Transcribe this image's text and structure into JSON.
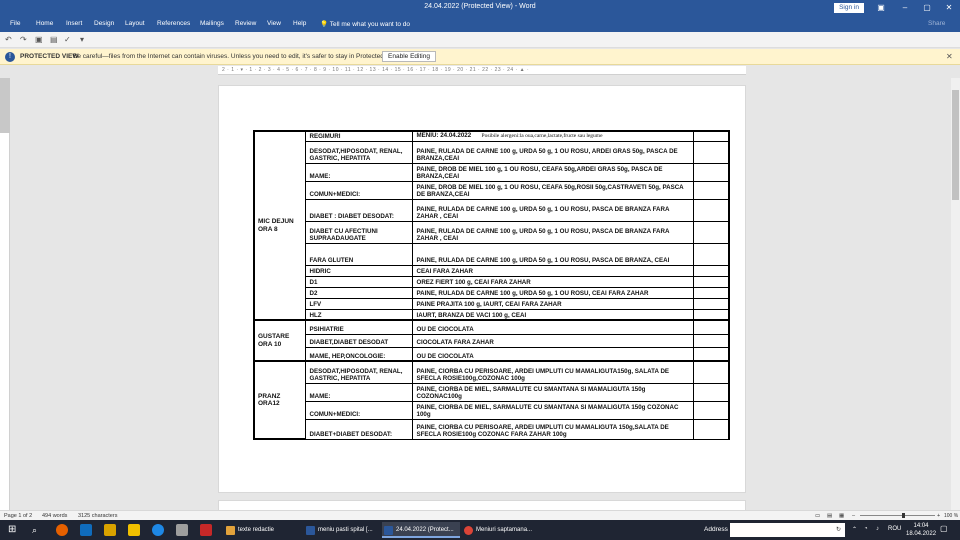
{
  "window": {
    "title": "24.04.2022 (Protected View) - Word",
    "sign_in": "Sign in"
  },
  "ribbon": {
    "tabs": [
      "File",
      "Home",
      "Insert",
      "Design",
      "Layout",
      "References",
      "Mailings",
      "Review",
      "View",
      "Help"
    ],
    "tell_me": "Tell me what you want to do",
    "share": "Share"
  },
  "protected_view": {
    "title": "PROTECTED VIEW",
    "message": "Be careful—files from the Internet can contain viruses. Unless you need to edit, it's safer to stay in Protected View.",
    "button": "Enable Editing"
  },
  "ruler": {
    "text": "2 · 1 · ▾ · 1 · 2 · 3 · 4 · 5 · 6 · 7 · 8 · 9 · 10 · 11 · 12 · 13 · 14 · 15 · 16 · 17 · 18 · 19 · 20 · 21 · 22 · 23 · 24 · ▲ ·"
  },
  "document": {
    "header_row": {
      "regimen": "REGIMURI",
      "menu": "MENIU: 24.04.2022",
      "note": "Posibile alergeni:la oua,carne,lactate,fructe sau legume"
    },
    "sections": [
      {
        "meal": "MIC DEJUN ORA 8",
        "rows": [
          {
            "regimen": "DESODAT,HIPOSODAT, RENAL, GASTRIC, HEPATITA",
            "menu": "PAINE, RULADA DE CARNE 100 g, URDA 50 g, 1 OU ROSU, ARDEI GRAS 50g, PASCA DE BRANZA,CEAI"
          },
          {
            "regimen": "MAME:",
            "menu": "PAINE, DROB DE MIEL 100 g, 1 OU ROSU, CEAFA 50g,ARDEI GRAS 50g, PASCA DE BRANZA,CEAI"
          },
          {
            "regimen": "COMUN+MEDICI:",
            "menu": "PAINE, DROB DE MIEL 100 g, 1 OU ROSU, CEAFA 50g,ROSII 50g,CASTRAVETI 50g, PASCA DE BRANZA,CEAI"
          },
          {
            "regimen": "DIABET : DIABET DESODAT:",
            "menu": "PAINE, RULADA DE CARNE 100 g, URDA 50 g, 1 OU ROSU, PASCA DE BRANZA FARA ZAHAR , CEAI"
          },
          {
            "regimen": "DIABET CU AFECTIUNI SUPRAADAUGATE",
            "menu": "PAINE, RULADA DE CARNE 100 g, URDA 50 g, 1 OU ROSU, PASCA DE BRANZA FARA ZAHAR , CEAI"
          },
          {
            "regimen": "FARA GLUTEN",
            "menu": "PAINE, RULADA DE CARNE 100 g, URDA 50 g, 1 OU ROSU, PASCA DE BRANZA, CEAI"
          },
          {
            "regimen": "HIDRIC",
            "menu": "CEAI FARA ZAHAR"
          },
          {
            "regimen": "D1",
            "menu": "OREZ FIERT 100 g, CEAI FARA ZAHAR"
          },
          {
            "regimen": "D2",
            "menu": "PAINE, RULADA DE CARNE 100 g, URDA 50 g, 1 OU ROSU, CEAI FARA ZAHAR"
          },
          {
            "regimen": "LFV",
            "menu": "PAINE PRAJITA 100 g, IAURT, CEAI FARA ZAHAR"
          },
          {
            "regimen": "HLZ",
            "menu": "IAURT, BRANZA DE VACI 100 g, CEAI"
          }
        ]
      },
      {
        "meal": "GUSTARE ORA 10",
        "rows": [
          {
            "regimen": "PSIHIATRIE",
            "menu": "OU DE CIOCOLATA"
          },
          {
            "regimen": "DIABET,DIABET DESODAT",
            "menu": "CIOCOLATA FARA ZAHAR"
          },
          {
            "regimen": "MAME, HEP,ONCOLOGIE:",
            "menu": "OU DE CIOCOLATA"
          }
        ]
      },
      {
        "meal": "PRANZ ORA12",
        "rows": [
          {
            "regimen": "DESODAT,HIPOSODAT, RENAL, GASTRIC, HEPATITA",
            "menu": "PAINE, CIORBA CU PERISOARE, ARDEI UMPLUTI CU MAMALIGUTA150g, SALATA DE SFECLA ROSIE100g,COZONAC 100g"
          },
          {
            "regimen": "MAME:",
            "menu": "PAINE, CIORBA DE MIEL, SARMALUTE CU SMANTANA SI MAMALIGUTA 150g COZONAC100g"
          },
          {
            "regimen": "COMUN+MEDICI:",
            "menu": "PAINE, CIORBA DE MIEL, SARMALUTE CU SMANTANA SI MAMALIGUTA 150g COZONAC 100g"
          },
          {
            "regimen": "DIABET+DIABET DESODAT:",
            "menu": "PAINE, CIORBA CU PERISOARE, ARDEI UMPLUTI CU MAMALIGUTA 150g,SALATA DE SFECLA ROSIE100g COZONAC FARA ZAHAR 100g"
          }
        ]
      }
    ]
  },
  "status": {
    "page": "Page 1 of 2",
    "words": "494 words",
    "chars": "3125 characters",
    "zoom": "100 %"
  },
  "taskbar": {
    "apps": [
      {
        "label": "texte redactie",
        "color": "#e2a23b"
      },
      {
        "label": "meniu pasti spital [...",
        "color": "#2b579a"
      },
      {
        "label": "24.04.2022 (Protect...",
        "color": "#2b579a"
      },
      {
        "label": "Meniuri saptamana...",
        "color": "#db4437"
      }
    ],
    "address_label": "Address",
    "lang": "ROU",
    "time": "14:04",
    "date": "18.04.2022"
  }
}
